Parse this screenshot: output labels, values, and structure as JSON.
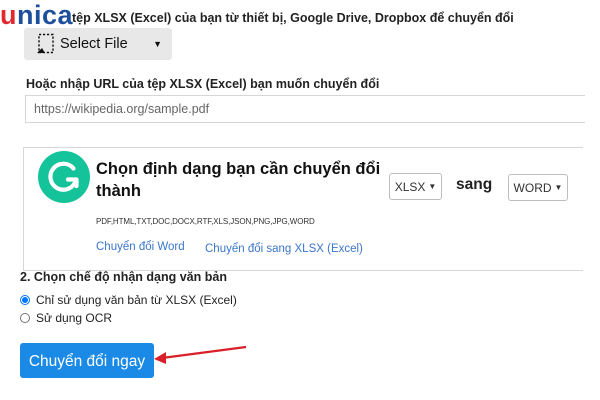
{
  "watermark": {
    "brand_first": "u",
    "brand_rest": "nica",
    "color_u": "#e0282e",
    "color_rest": "#1d4f9c"
  },
  "upload": {
    "instruction_partial": "tệp XLSX (Excel) của bạn từ thiết bị, Google Drive, Dropbox để chuyển đổi",
    "select_file_label": "Select File"
  },
  "url": {
    "label": "Hoặc nhập URL của tệp XLSX (Excel) bạn muốn chuyển đổi",
    "placeholder": "https://wikipedia.org/sample.pdf"
  },
  "format_card": {
    "title": "Chọn định dạng bạn cần chuyển đổi thành",
    "from_format": "XLSX",
    "connector": "sang",
    "to_format": "WORD",
    "supported_formats": "PDF,HTML,TXT,DOC,DOCX,RTF,XLS,JSON,PNG,JPG,WORD",
    "link_1": "Chuyển đổi Word",
    "link_2": "Chuyển đổi sang XLSX (Excel)",
    "icon_color": "#15c39a"
  },
  "recognition": {
    "heading": "2. Chọn chế độ nhận dạng văn bản",
    "options": [
      {
        "label": "Chỉ sử dụng văn bản từ XLSX (Excel)",
        "checked": true
      },
      {
        "label": "Sử dụng OCR",
        "checked": false
      }
    ]
  },
  "action": {
    "convert_label": "Chuyển đổi ngay",
    "button_color": "#1a8ae6",
    "arrow_color": "#d9202a"
  }
}
